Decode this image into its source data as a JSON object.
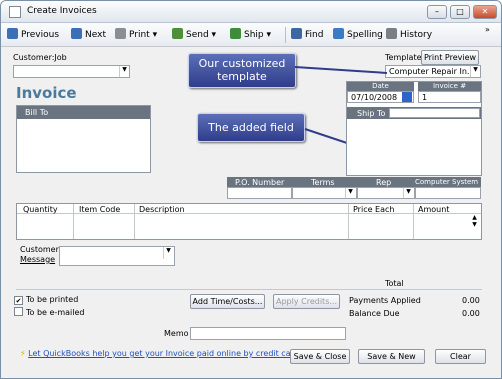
{
  "window": {
    "title": "Create Invoices"
  },
  "toolbar": {
    "previous": "Previous",
    "next": "Next",
    "print": "Print",
    "send": "Send",
    "ship": "Ship",
    "find": "Find",
    "spelling": "Spelling",
    "history": "History"
  },
  "header": {
    "customer_job_label": "Customer:Job",
    "template_label": "Template",
    "print_preview": "Print Preview",
    "template_value": "Computer Repair In...",
    "form_title": "Invoice",
    "date_label": "Date",
    "date_value": "07/10/2008",
    "invoice_no_label": "Invoice #",
    "invoice_no_value": "1",
    "bill_to_label": "Bill To",
    "ship_to_label": "Ship To"
  },
  "callouts": {
    "template": "Our customized template",
    "field": "The added field"
  },
  "order_fields": {
    "po_number": "P.O. Number",
    "terms": "Terms",
    "rep": "Rep",
    "computer_system": "Computer System"
  },
  "line_items": {
    "columns": [
      "Quantity",
      "Item Code",
      "Description",
      "Price Each",
      "Amount"
    ]
  },
  "footer": {
    "customer_message_label_1": "Customer",
    "customer_message_label_2": "Message",
    "total_label": "Total",
    "to_be_printed": "To be printed",
    "to_be_emailed": "To be e-mailed",
    "add_time_costs": "Add Time/Costs...",
    "apply_credits": "Apply Credits...",
    "payments_applied_label": "Payments Applied",
    "payments_applied_value": "0.00",
    "balance_due_label": "Balance Due",
    "balance_due_value": "0.00",
    "memo_label": "Memo",
    "help_link": "Let QuickBooks help you get your Invoice paid online by credit card.",
    "save_close": "Save & Close",
    "save_new": "Save & New",
    "clear": "Clear"
  }
}
